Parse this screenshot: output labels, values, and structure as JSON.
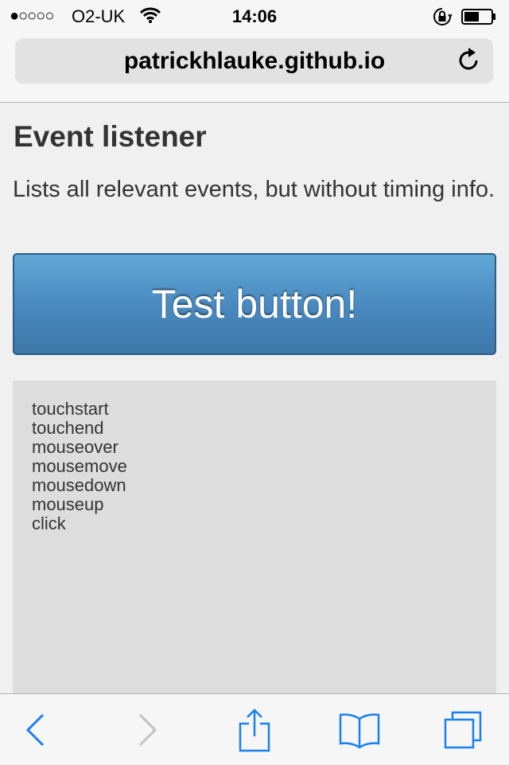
{
  "status_bar": {
    "signal": "●○○○○",
    "carrier": "O2-UK",
    "time": "14:06"
  },
  "browser": {
    "url": "patrickhlauke.github.io"
  },
  "page": {
    "title": "Event listener",
    "description": "Lists all relevant events, but without timing info.",
    "button_label": "Test button!",
    "events": [
      "touchstart",
      "touchend",
      "mouseover",
      "mousemove",
      "mousedown",
      "mouseup",
      "click"
    ]
  },
  "colors": {
    "accent": "#1a7ff2",
    "button_top": "#61a8d6",
    "button_bottom": "#3d77a8",
    "log_bg": "#dddddd"
  },
  "toolbar": {
    "back_enabled": true,
    "forward_enabled": false,
    "icons": [
      "back-icon",
      "forward-icon",
      "share-icon",
      "bookmarks-icon",
      "tabs-icon"
    ]
  }
}
